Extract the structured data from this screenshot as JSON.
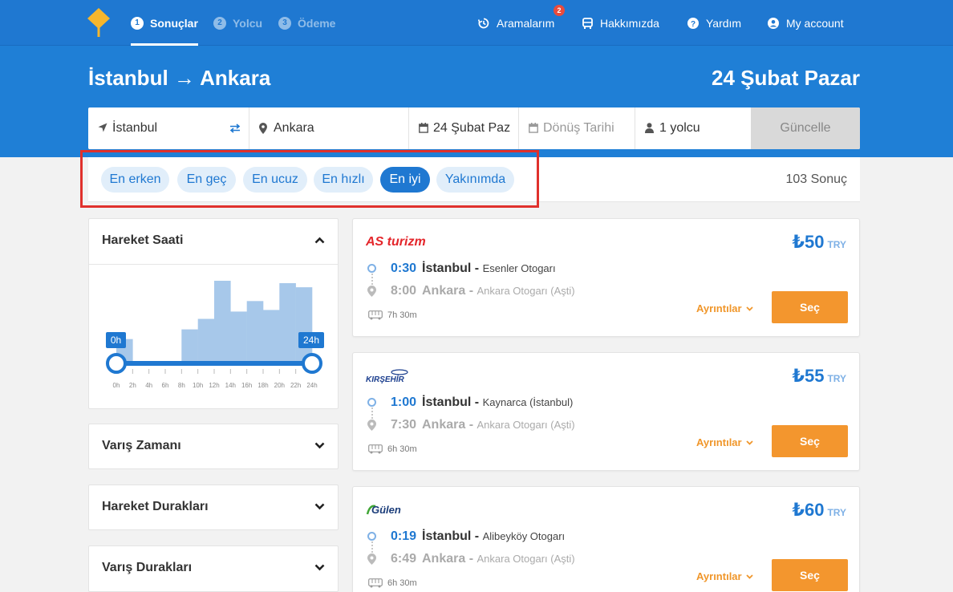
{
  "nav": {
    "steps": [
      {
        "num": "1",
        "label": "Sonuçlar"
      },
      {
        "num": "2",
        "label": "Yolcu"
      },
      {
        "num": "3",
        "label": "Ödeme"
      }
    ],
    "links": {
      "searches": "Aramalarım",
      "searches_badge": "2",
      "about": "Hakkımızda",
      "help": "Yardım",
      "account": "My account"
    }
  },
  "header": {
    "route": "İstanbul → Ankara",
    "date": "24 Şubat Pazar"
  },
  "search": {
    "origin": "İstanbul",
    "destination": "Ankara",
    "depart_date": "24 Şubat Paz",
    "return_placeholder": "Dönüş Tarihi",
    "passengers": "1 yolcu",
    "update_label": "Güncelle"
  },
  "sort": {
    "options": [
      "En erken",
      "En geç",
      "En ucuz",
      "En hızlı",
      "En iyi",
      "Yakınımda"
    ],
    "active": "En iyi",
    "result_count": "103 Sonuç"
  },
  "filters": {
    "departure_time": {
      "title": "Hareket Saati",
      "range_min_label": "0h",
      "range_max_label": "24h",
      "ticks": [
        "0h",
        "2h",
        "4h",
        "6h",
        "8h",
        "10h",
        "12h",
        "14h",
        "16h",
        "18h",
        "20h",
        "22h",
        "24h"
      ],
      "histogram_levels": [
        0.28,
        0,
        0,
        0,
        0.4,
        0.53,
        1.0,
        0.62,
        0.75,
        0.64,
        0.97,
        0.92
      ]
    },
    "arrival_time": {
      "title": "Varış Zamanı"
    },
    "departure_stops": {
      "title": "Hareket Durakları"
    },
    "arrival_stops": {
      "title": "Varış Durakları"
    }
  },
  "results": [
    {
      "operator": "AS turizm",
      "price": "₺50",
      "currency": "TRY",
      "dep_time": "0:30",
      "dep_city": "İstanbul -",
      "dep_station": "Esenler Otogarı",
      "arr_time": "8:00",
      "arr_city": "Ankara -",
      "arr_station": "Ankara Otogarı (Aşti)",
      "duration": "7h 30m",
      "details_label": "Ayrıntılar",
      "select_label": "Seç"
    },
    {
      "operator": "KIRŞEHİR",
      "price": "₺55",
      "currency": "TRY",
      "dep_time": "1:00",
      "dep_city": "İstanbul -",
      "dep_station": "Kaynarca (İstanbul)",
      "arr_time": "7:30",
      "arr_city": "Ankara -",
      "arr_station": "Ankara Otogarı (Aşti)",
      "duration": "6h 30m",
      "details_label": "Ayrıntılar",
      "select_label": "Seç"
    },
    {
      "operator": "Gülen",
      "price": "₺60",
      "currency": "TRY",
      "dep_time": "0:19",
      "dep_city": "İstanbul -",
      "dep_station": "Alibeyköy Otogarı",
      "arr_time": "6:49",
      "arr_city": "Ankara -",
      "arr_station": "Ankara Otogarı (Aşti)",
      "duration": "6h 30m",
      "details_label": "Ayrıntılar",
      "select_label": "Seç"
    }
  ],
  "colors": {
    "brand_blue": "#1f78d1",
    "accent_orange": "#f3962e",
    "highlight_red": "#e0312c"
  }
}
